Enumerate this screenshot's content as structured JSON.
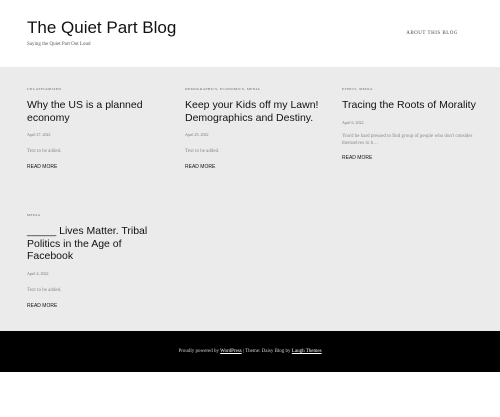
{
  "header": {
    "site_title": "The Quiet Part Blog",
    "tagline": "Saying the Quiet Part Out Loud",
    "nav_about": "ABOUT THIS BLOG"
  },
  "posts": [
    {
      "categories": "UNCATEGORIZED",
      "title": "Why the US is a planned economy",
      "date": "April 27, 2022",
      "excerpt": "Text to be added.",
      "read_more": "READ MORE"
    },
    {
      "categories": "DEMOGRAPHICS, ECONOMICS, MEDIA",
      "title": "Keep your Kids off my Lawn! Demographics and Destiny.",
      "date": "April 25, 2022",
      "excerpt": "Text to be added.",
      "read_more": "READ MORE"
    },
    {
      "categories": "ETHICS, MEDIA",
      "title": "Tracing the Roots of Morality",
      "date": "April 6, 2022",
      "excerpt": "You'd be hard pressed to find group of people who don't consider themselves to b…",
      "read_more": "READ MORE"
    },
    {
      "categories": "MEDIA",
      "title": "_____ Lives Matter. Tribal Politics in the Age of Facebook",
      "date": "April 4, 2022",
      "excerpt": "Text to be added.",
      "read_more": "READ MORE"
    }
  ],
  "footer": {
    "prefix": "Proudly powered by",
    "wordpress": "WordPress",
    "middle": "| Theme: Daisy Blog by",
    "themes_link": "Laugh Themes"
  },
  "colors": {
    "content_bg": "#ebebeb",
    "footer_bg": "#000000"
  }
}
